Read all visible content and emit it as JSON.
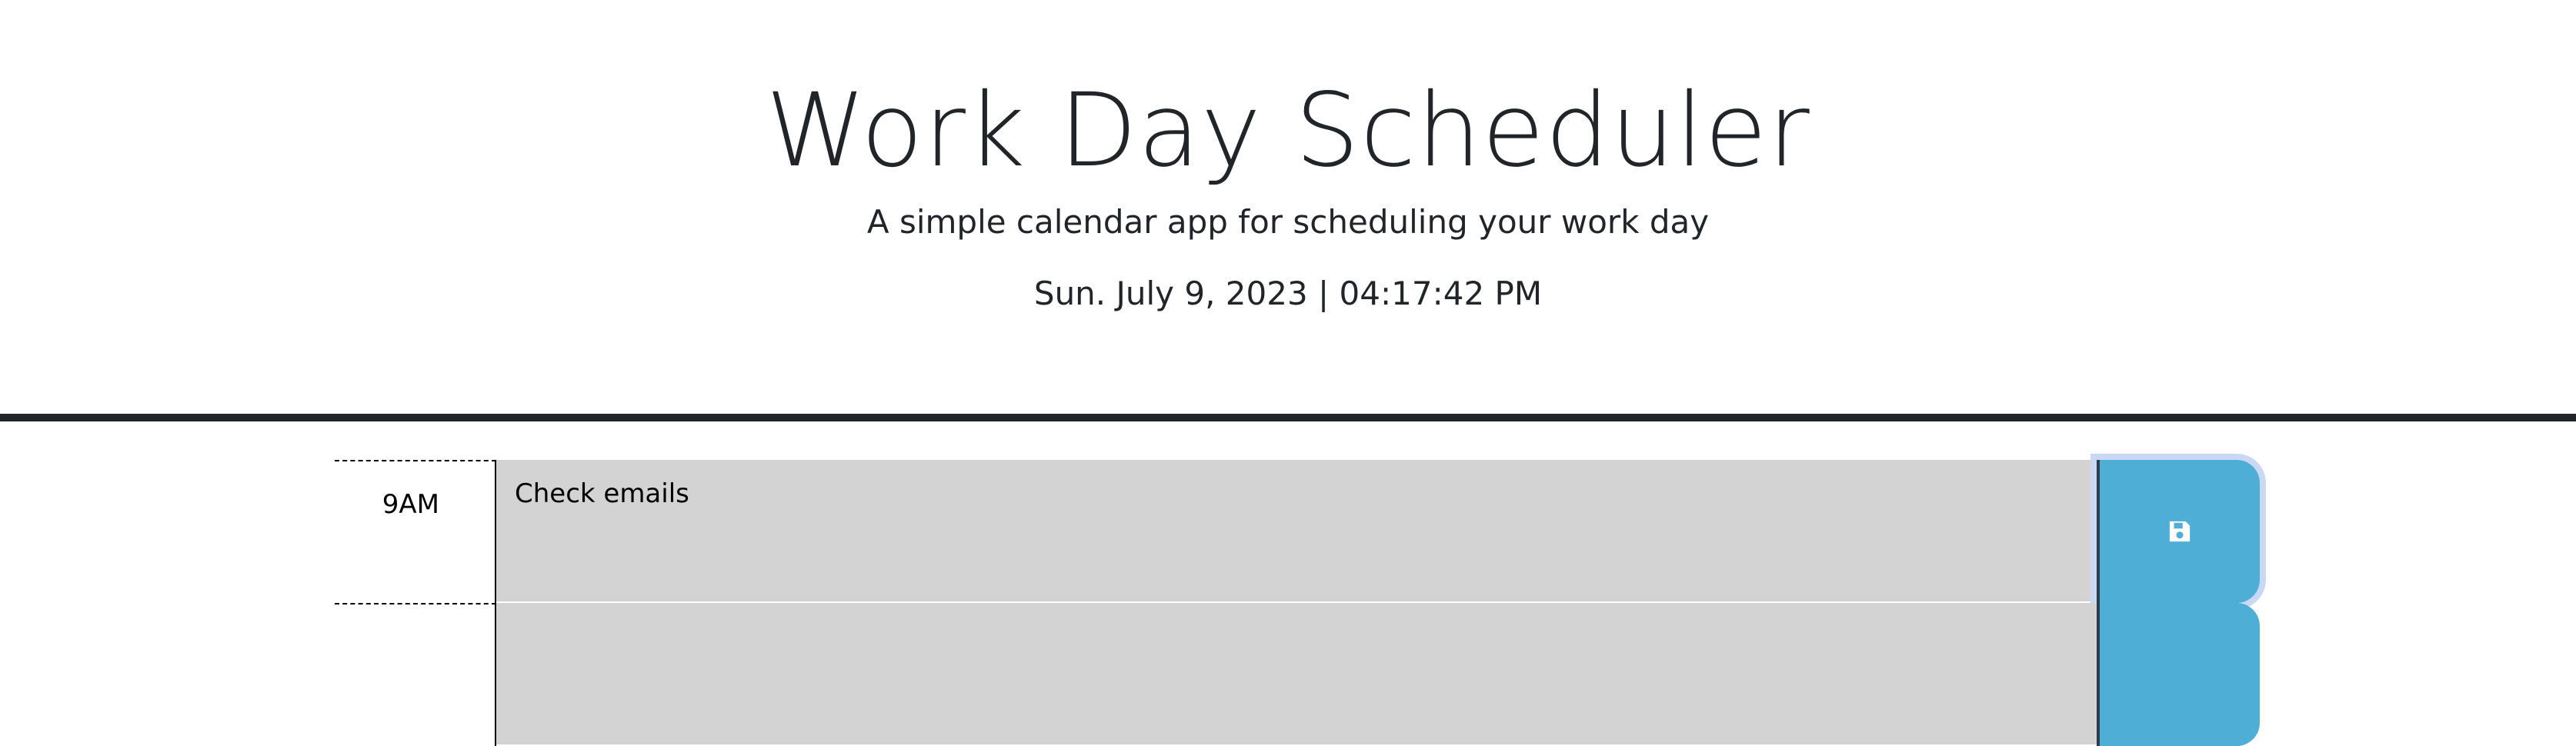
{
  "header": {
    "title": "Work Day Scheduler",
    "subtitle": "A simple calendar app for scheduling your work day",
    "datetime": "Sun. July 9, 2023 | 04:17:42 PM"
  },
  "time_blocks": [
    {
      "hour": "9AM",
      "text": "Check emails",
      "save_icon": "save-icon"
    },
    {
      "hour": "",
      "text": "",
      "save_icon": "save-icon"
    }
  ],
  "colors": {
    "past_block": "#d3d3d3",
    "save_button": "#4eaed6",
    "focus_ring": "#c8d8f5",
    "divider": "#212529"
  }
}
